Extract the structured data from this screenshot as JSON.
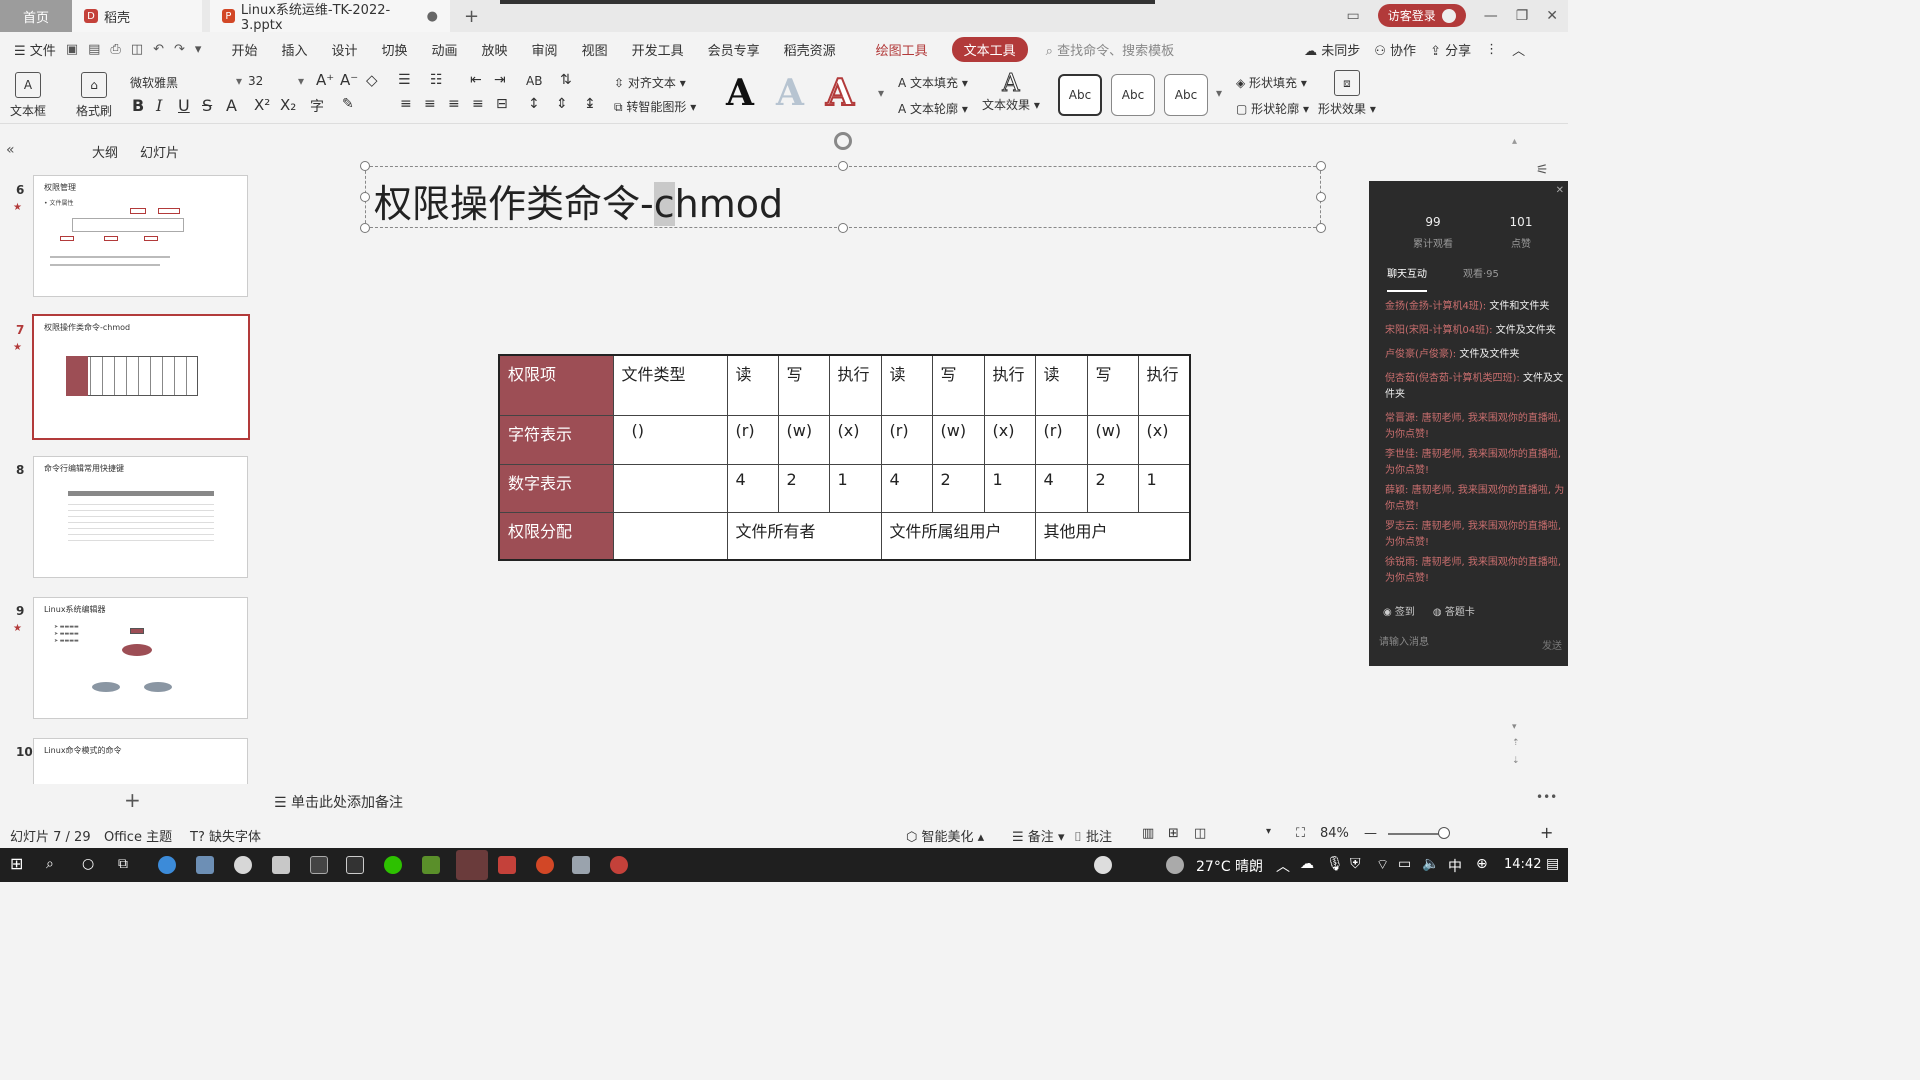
{
  "titlebar": {
    "home_tab": "首页",
    "docer_tab": "稻壳",
    "doc_tab": "Linux系统运维-TK-2022-3.pptx",
    "visitor_login": "访客登录"
  },
  "menu": {
    "file": "文件",
    "items": [
      "开始",
      "插入",
      "设计",
      "切换",
      "动画",
      "放映",
      "审阅",
      "视图",
      "开发工具",
      "会员专享",
      "稻壳资源"
    ],
    "draw_tools": "绘图工具",
    "text_tools": "文本工具",
    "search_placeholder": "查找命令、搜索模板",
    "sync": "未同步",
    "collab": "协作",
    "share": "分享"
  },
  "ribbon": {
    "textbox": "文本框",
    "format_painter": "格式刷",
    "font_name": "微软雅黑",
    "font_size": "32",
    "align_text": "对齐文本",
    "smart_art": "转智能图形",
    "text_fill": "文本填充",
    "text_outline": "文本轮廓",
    "text_effect": "文本效果",
    "style_sample": "Abc",
    "shape_fill": "形状填充",
    "shape_outline": "形状轮廓",
    "shape_effect": "形状效果"
  },
  "left_panel": {
    "outline_tab": "大纲",
    "slides_tab": "幻灯片",
    "slides": [
      {
        "num": "6",
        "title": "权限管理"
      },
      {
        "num": "7",
        "title": "权限操作类命令-chmod"
      },
      {
        "num": "8",
        "title": "命令行编辑常用快捷键"
      },
      {
        "num": "9",
        "title": "Linux系统编辑器"
      },
      {
        "num": "10",
        "title": "Linux命令模式的命令"
      }
    ]
  },
  "slide": {
    "title_before": "权限操作类命令-",
    "title_cursor": "c",
    "title_after": "hmod",
    "table": {
      "row1": [
        "权限项",
        "文件类型",
        "读",
        "写",
        "执行",
        "读",
        "写",
        "执行",
        "读",
        "写",
        "执行"
      ],
      "row2": [
        "字符表示",
        "()",
        "(r)",
        "(w)",
        "(x)",
        "(r)",
        "(w)",
        "(x)",
        "(r)",
        "(w)",
        "(x)"
      ],
      "row3": [
        "数字表示",
        "",
        "4",
        "2",
        "1",
        "4",
        "2",
        "1",
        "4",
        "2",
        "1"
      ],
      "row4": [
        "权限分配",
        "",
        "文件所有者",
        "文件所属组用户",
        "其他用户"
      ]
    },
    "notes_placeholder": "单击此处添加备注"
  },
  "chat": {
    "views_num": "99",
    "views_label": "累计观看",
    "likes_num": "101",
    "likes_label": "点赞",
    "tab_chat": "聊天互动",
    "tab_watch": "观看·95",
    "messages": [
      {
        "user": "金扬(金扬-计算机4班):",
        "text": "文件和文件夹"
      },
      {
        "user": "宋阳(宋阳-计算机04班):",
        "text": "文件及文件夹"
      },
      {
        "user": "卢俊豪(卢俊豪):",
        "text": "文件及文件夹"
      },
      {
        "user": "倪杏茹(倪杏茹-计算机类四班):",
        "text": "文件及文件夹"
      },
      {
        "user": "常晋源:",
        "text": "唐韧老师, 我来围观你的直播啦, 为你点赞!"
      },
      {
        "user": "李世佳:",
        "text": "唐韧老师, 我来围观你的直播啦, 为你点赞!"
      },
      {
        "user": "薛颖:",
        "text": "唐韧老师, 我来围观你的直播啦, 为你点赞!"
      },
      {
        "user": "罗志云:",
        "text": "唐韧老师, 我来围观你的直播啦, 为你点赞!"
      },
      {
        "user": "徐锐雨:",
        "text": "唐韧老师, 我来围观你的直播啦, 为你点赞!"
      }
    ],
    "checkin": "签到",
    "answer_card": "答题卡",
    "input_placeholder": "请输入消息",
    "send": "发送"
  },
  "status": {
    "slide_pos": "幻灯片 7 / 29",
    "theme": "Office 主题",
    "missing_font": "缺失字体",
    "smart_beautify": "智能美化",
    "notes": "备注",
    "comments": "批注",
    "zoom": "84%"
  },
  "taskbar": {
    "weather": "27°C 晴朗",
    "ime": "中",
    "time": "14:42"
  }
}
